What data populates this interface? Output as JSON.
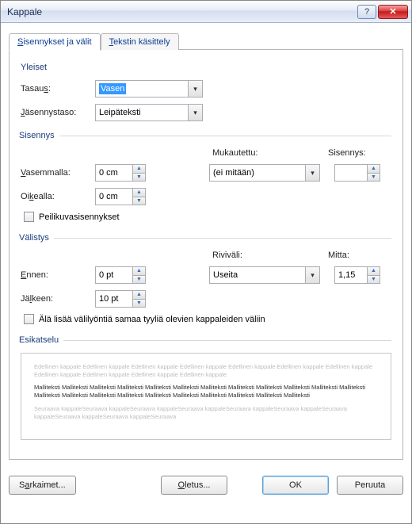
{
  "window": {
    "title": "Kappale",
    "help_label": "?",
    "close_label": "✕"
  },
  "tabs": {
    "indent": "Sisennykset ja välit",
    "text": "Tekstin käsittely"
  },
  "general": {
    "legend": "Yleiset",
    "alignment_label": "Tasaus:",
    "alignment_value": "Vasen",
    "outline_label": "Jäsennystaso:",
    "outline_value": "Leipäteksti"
  },
  "indent": {
    "legend": "Sisennys",
    "left_label": "Vasemmalla:",
    "left_value": "0 cm",
    "right_label": "Oikealla:",
    "right_value": "0 cm",
    "special_label": "Mukautettu:",
    "special_value": "(ei mitään)",
    "by_label": "Sisennys:",
    "by_value": "",
    "mirror_label": "Peilikuvasisennykset"
  },
  "spacing": {
    "legend": "Välistys",
    "before_label": "Ennen:",
    "before_value": "0 pt",
    "after_label": "Jälkeen:",
    "after_value": "10 pt",
    "line_label": "Riviväli:",
    "line_value": "Useita",
    "at_label": "Mitta:",
    "at_value": "1,15",
    "nospace_label": "Älä lisää välilyöntiä samaa tyyliä olevien kappaleiden väliin"
  },
  "preview": {
    "legend": "Esikatselu",
    "prev": "Edellinen kappale Edellinen kappale Edellinen kappale Edellinen kappale Edellinen kappale Edellinen kappale Edellinen kappale Edellinen kappale Edellinen kappale Edellinen kappale Edellinen kappale",
    "body": "Malliteksti Malliteksti Malliteksti Malliteksti Malliteksti Malliteksti Malliteksti Malliteksti Malliteksti Malliteksti Malliteksti Malliteksti Malliteksti Malliteksti Malliteksti Malliteksti Malliteksti Malliteksti Malliteksti Malliteksti Malliteksti Malliteksti",
    "next": "Seuraava kappaleSeuraava kappaleSeuraava kappaleSeuraava kappaleSeuraava kappaleSeuraava kappaleSeuraava kappaleSeuraava kappaleSeuraava kappaleSeuraava"
  },
  "buttons": {
    "tabs": "Sarkaimet...",
    "default": "Oletus...",
    "ok": "OK",
    "cancel": "Peruuta"
  }
}
